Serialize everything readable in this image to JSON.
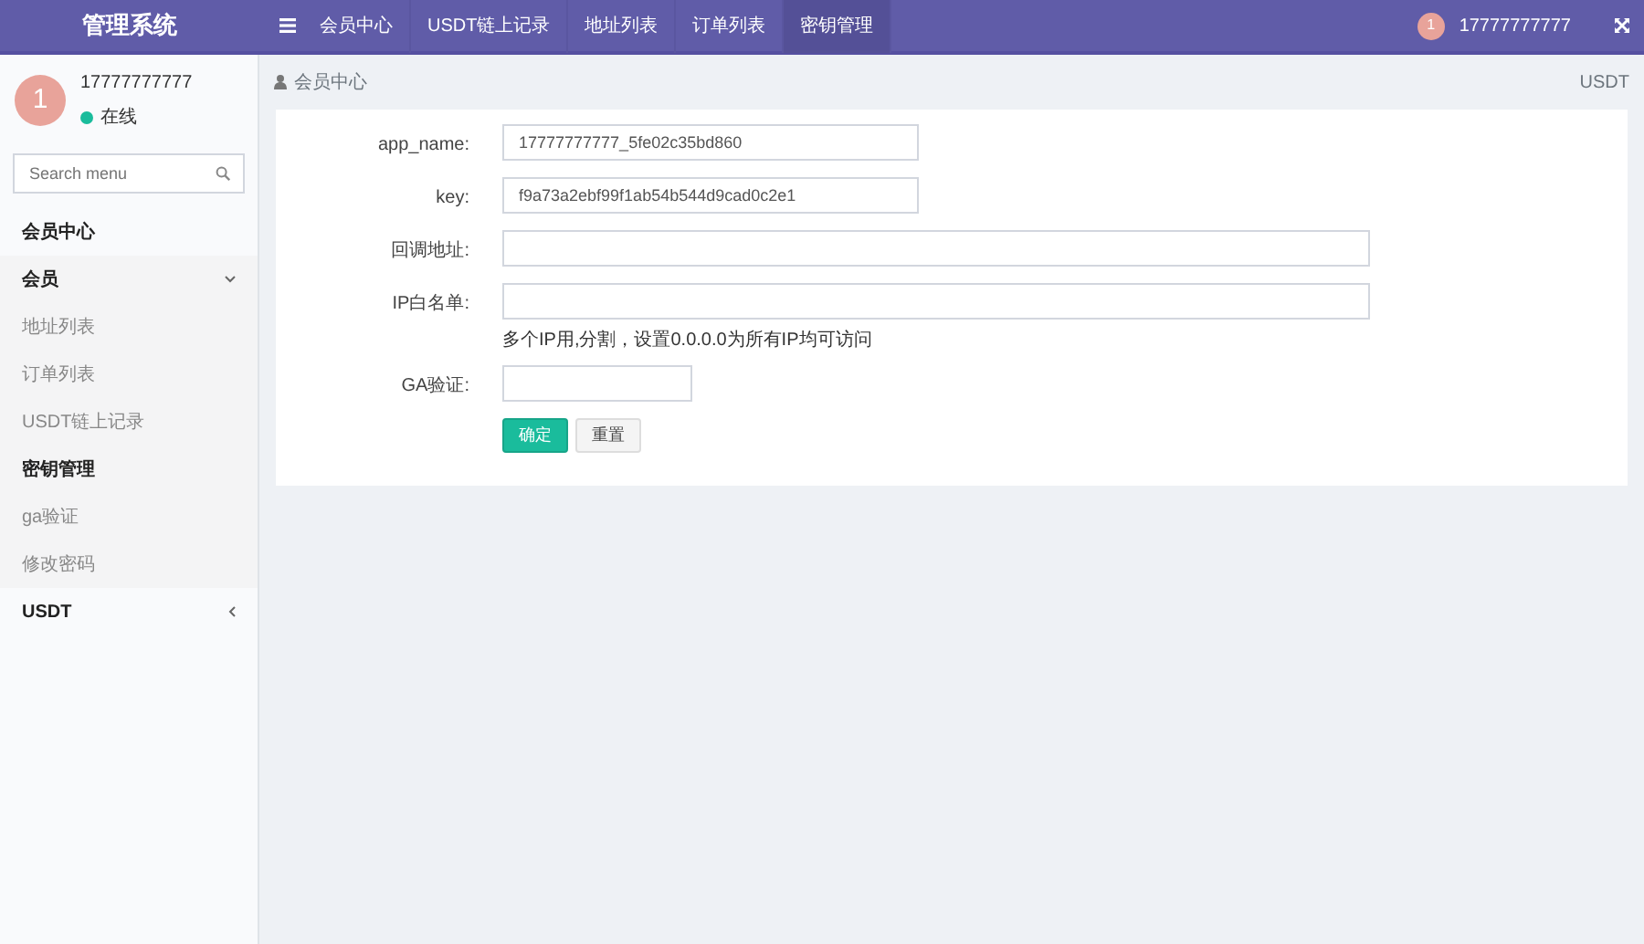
{
  "brand": "管理系统",
  "nav_tabs": [
    {
      "label": "会员中心",
      "selected": false
    },
    {
      "label": "USDT链上记录",
      "selected": false
    },
    {
      "label": "地址列表",
      "selected": false
    },
    {
      "label": "订单列表",
      "selected": false
    },
    {
      "label": "密钥管理",
      "selected": true
    }
  ],
  "top_user": {
    "avatar": "1",
    "name": "17777777777"
  },
  "sidebar": {
    "user": {
      "avatar": "1",
      "name": "17777777777",
      "status": "在线"
    },
    "search": {
      "placeholder": "Search menu"
    },
    "items": [
      {
        "label": "会员中心",
        "kind": "link",
        "selected": false
      },
      {
        "label": "会员",
        "kind": "group",
        "expanded": true,
        "children": [
          {
            "label": "地址列表",
            "selected": false
          },
          {
            "label": "订单列表",
            "selected": false
          },
          {
            "label": "USDT链上记录",
            "selected": false
          },
          {
            "label": "密钥管理",
            "selected": true
          },
          {
            "label": "ga验证",
            "selected": false
          },
          {
            "label": "修改密码",
            "selected": false
          }
        ]
      },
      {
        "label": "USDT",
        "kind": "group",
        "expanded": false
      }
    ]
  },
  "breadcrumb": {
    "current": "会员中心",
    "right": "USDT"
  },
  "form": {
    "fields": [
      {
        "label": "app_name:",
        "value": "17777777777_5fe02c35bd860",
        "kind": "medium"
      },
      {
        "label": "key:",
        "value": "f9a73a2ebf99f1ab54b544d9cad0c2e1",
        "kind": "medium"
      },
      {
        "label": "回调地址:",
        "kind": "wide"
      },
      {
        "label": "IP白名单:",
        "kind": "wide",
        "help": "多个IP用,分割，设置0.0.0.0为所有IP均可访问"
      },
      {
        "label": "GA验证:",
        "kind": "narrow"
      }
    ],
    "buttons": [
      {
        "label": "确定",
        "kind": "primary"
      },
      {
        "label": "重置",
        "kind": "default"
      }
    ]
  }
}
